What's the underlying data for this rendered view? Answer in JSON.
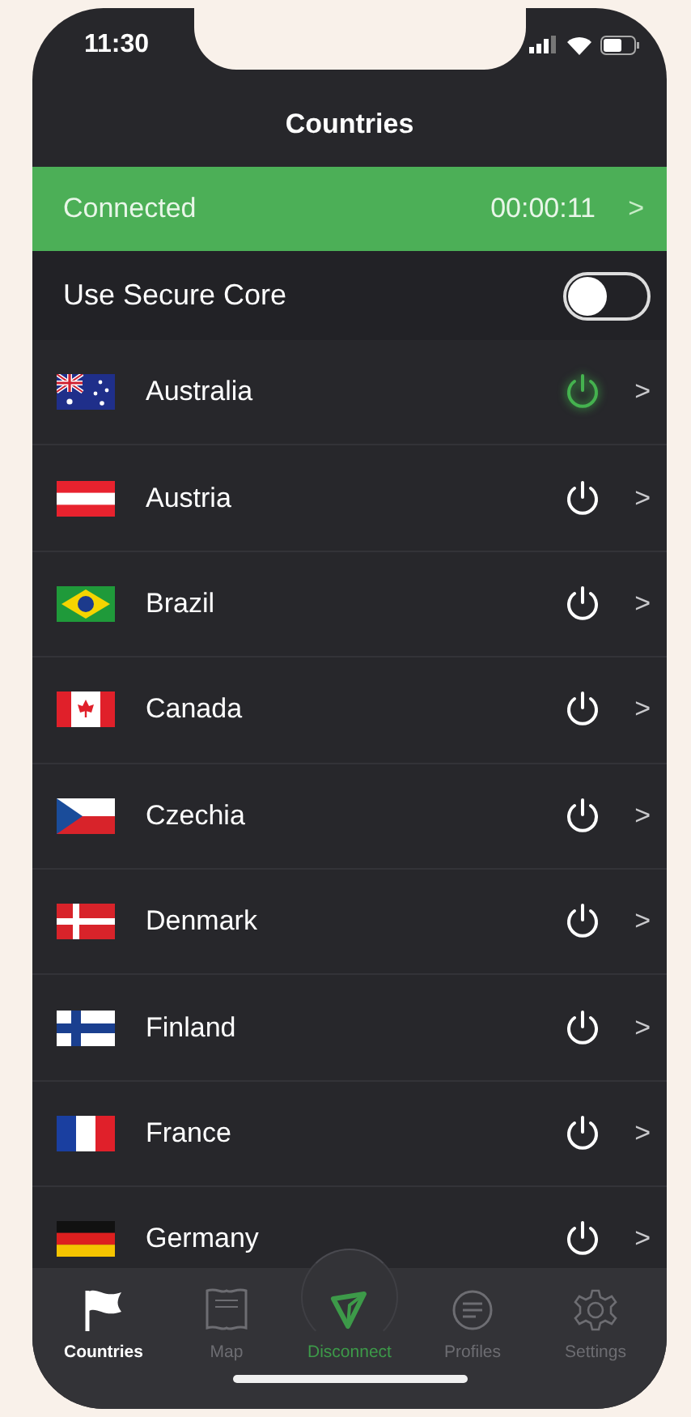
{
  "status_bar": {
    "time": "11:30"
  },
  "title": "Countries",
  "connection_bar": {
    "status": "Connected",
    "timer": "00:00:11",
    "chevron": ">"
  },
  "secure_core": {
    "label": "Use Secure Core",
    "on": false
  },
  "countries": [
    {
      "name": "Australia",
      "kind": "au",
      "connected": true,
      "chevron": ">"
    },
    {
      "name": "Austria",
      "kind": "at",
      "connected": false,
      "chevron": ">"
    },
    {
      "name": "Brazil",
      "kind": "br",
      "connected": false,
      "chevron": ">"
    },
    {
      "name": "Canada",
      "kind": "ca",
      "connected": false,
      "chevron": ">"
    },
    {
      "name": "Czechia",
      "kind": "cz",
      "connected": false,
      "chevron": ">"
    },
    {
      "name": "Denmark",
      "kind": "dk",
      "connected": false,
      "chevron": ">"
    },
    {
      "name": "Finland",
      "kind": "fi",
      "connected": false,
      "chevron": ">"
    },
    {
      "name": "France",
      "kind": "fr",
      "connected": false,
      "chevron": ">"
    },
    {
      "name": "Germany",
      "kind": "de",
      "connected": false,
      "chevron": ">"
    }
  ],
  "tabs": [
    {
      "label": "Countries",
      "kind": "flag",
      "selected": true
    },
    {
      "label": "Map",
      "kind": "map",
      "selected": false
    },
    {
      "label": "Disconnect",
      "kind": "action",
      "selected": false
    },
    {
      "label": "Profiles",
      "kind": "profiles",
      "selected": false
    },
    {
      "label": "Settings",
      "kind": "settings",
      "selected": false
    }
  ]
}
